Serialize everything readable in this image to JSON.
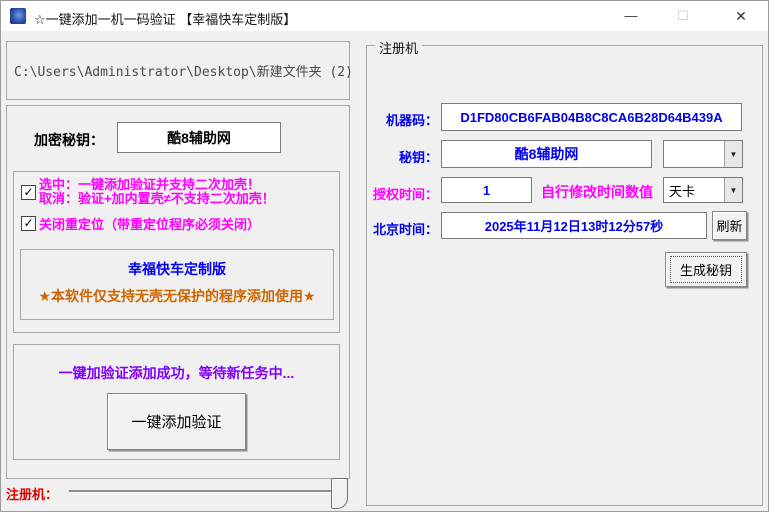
{
  "window": {
    "title": "☆一键添加一机一码验证 【幸福快车定制版】",
    "minimize": "—",
    "maximize": "☐",
    "close": "✕"
  },
  "icons": {
    "check": "✓",
    "dropdown": "▼"
  },
  "left": {
    "path": "C:\\Users\\Administrator\\Desktop\\新建文件夹 (2)",
    "key_label": "加密秘钥：",
    "key_value": "酷8辅助网",
    "option1_line1": "选中：一键添加验证并支持二次加壳！",
    "option1_line2": "取消：验证+加内置壳≠不支持二次加壳！",
    "option2": "关闭重定位（带重定位程序必须关闭）",
    "edition": "幸福快车定制版",
    "warning": "★本软件仅支持无壳无保护的程序添加使用★",
    "status": "一键加验证添加成功，等待新任务中...",
    "add_button": "一键添加验证",
    "bottom_label": "注册机："
  },
  "right": {
    "group_title": "注册机",
    "machine_code_label": "机器码：",
    "machine_code": "D1FD80CB6FAB04B8C8CA6B28D64B439A",
    "key_label": "秘钥：",
    "key_value": "酷8辅助网",
    "auth_label": "授权时间：",
    "auth_value": "1",
    "auth_hint": "自行修改时间数值",
    "card_type": "天卡",
    "time_label": "北京时间：",
    "time_value": "2025年11月12日13时12分57秒",
    "refresh_button": "刷新",
    "generate_button": "生成秘钥"
  },
  "colors": {
    "magenta": "#FF00FF",
    "blue": "#0000EE",
    "orange": "#CC6600",
    "purple": "#8000FF",
    "red": "#E00000"
  }
}
